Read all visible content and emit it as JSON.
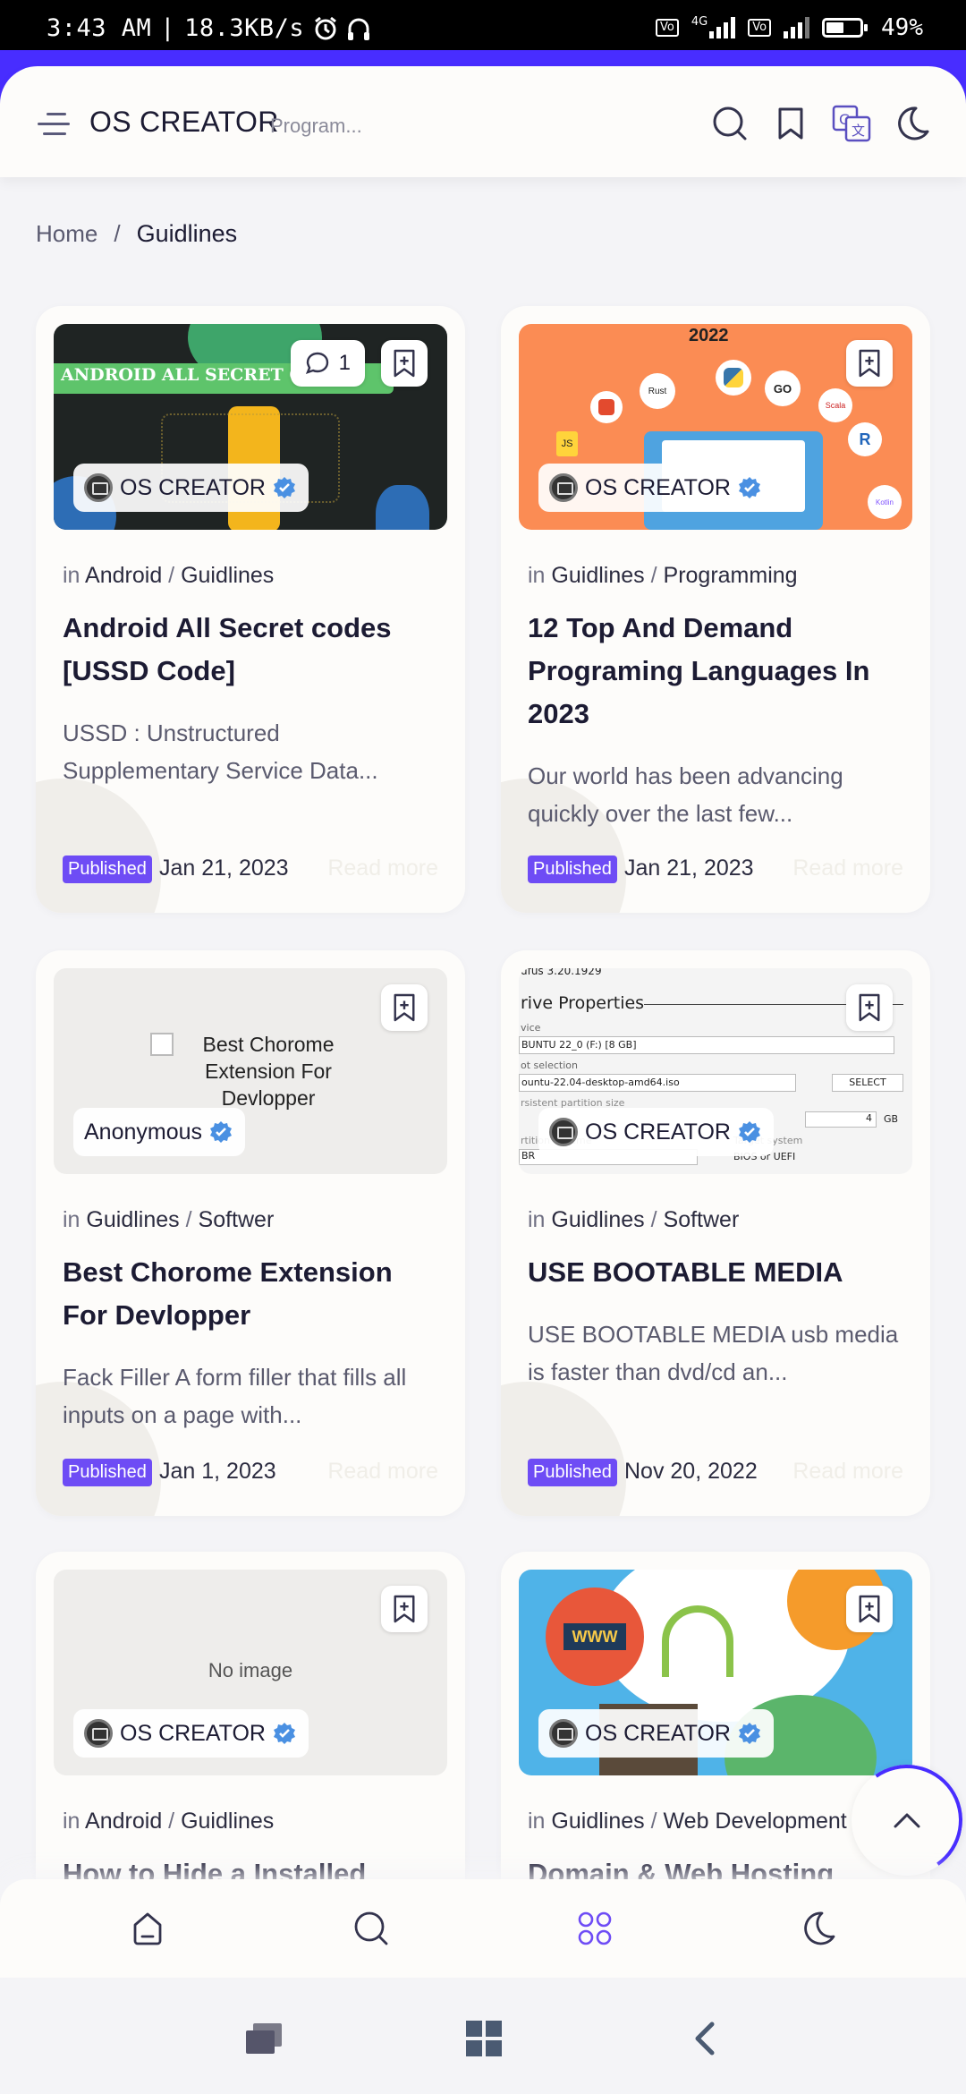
{
  "status_bar": {
    "time": "3:43 AM",
    "separator": "|",
    "speed": "18.3KB/s",
    "network": "4G",
    "battery": "49%"
  },
  "header": {
    "brand": "OS CREATOR",
    "subtitle": "Program..."
  },
  "breadcrumb": {
    "home": "Home",
    "separator": "/",
    "current": "Guidlines"
  },
  "posts": [
    {
      "category_prefix": "in",
      "category_1": "Android",
      "category_sep": "/",
      "category_2": "Guidlines",
      "title": "Android All Secret codes [USSD Code]",
      "excerpt": "USSD : Unstructured Supplementary Service Data...",
      "badge": "Published",
      "date": "Jan 21, 2023",
      "read_more": "Read more",
      "author": "OS CREATOR",
      "comments": "1",
      "thumb_text": "ANDROID ALL SECRET CODES"
    },
    {
      "category_prefix": "in",
      "category_1": "Guidlines",
      "category_sep": "/",
      "category_2": "Programming",
      "title": "12 Top And Demand Programing Languages In 2023",
      "excerpt": "Our world has been advancing quickly over the last few...",
      "badge": "Published",
      "date": "Jan 21, 2023",
      "read_more": "Read more",
      "author": "OS CREATOR",
      "thumb_text": "2022",
      "thumb_badges": [
        "Rust",
        "GO",
        "Scala",
        "R",
        "Kotlin",
        "JS"
      ]
    },
    {
      "category_prefix": "in",
      "category_1": "Guidlines",
      "category_sep": "/",
      "category_2": "Softwer",
      "title": "Best Chorome Extension For Devlopper",
      "excerpt": "Fack Filler A form filler that fills all inputs on a page with...",
      "badge": "Published",
      "date": "Jan 1, 2023",
      "read_more": "Read more",
      "author": "Anonymous",
      "thumb_alt": "Best Chorome Extension For Devlopper"
    },
    {
      "category_prefix": "in",
      "category_1": "Guidlines",
      "category_sep": "/",
      "category_2": "Softwer",
      "title": "USE BOOTABLE MEDIA",
      "excerpt": "USE BOOTABLE MEDIA usb media is faster than dvd/cd an...",
      "badge": "Published",
      "date": "Nov 20, 2022",
      "read_more": "Read more",
      "author": "OS CREATOR",
      "thumb_lines": {
        "version": "ufus 3.20.1929",
        "heading": "rive Properties",
        "device_label": "vice",
        "device": "BUNTU 22_0 (F:) [8 GB]",
        "boot_label": "ot selection",
        "iso": "ountu-22.04-desktop-amd64.iso",
        "select": "SELECT",
        "persist": "rsistent partition size",
        "size": "4",
        "unit": "GB",
        "scheme_label": "rtition scheme",
        "target_label": "Target system",
        "scheme": "BR",
        "target": "BIOS or UEFI"
      }
    },
    {
      "category_prefix": "in",
      "category_1": "Android",
      "category_sep": "/",
      "category_2": "Guidlines",
      "title": "How to Hide a Installed",
      "author": "OS CREATOR",
      "thumb_text": "No image"
    },
    {
      "category_prefix": "in",
      "category_1": "Guidlines",
      "category_sep": "/",
      "category_2": "Web Development",
      "title": "Domain & Web Hosting",
      "author": "OS CREATOR",
      "thumb_text": "WWW"
    }
  ],
  "colors": {
    "accent": "#482dff",
    "badge": "#6e4cf5",
    "card": "#fdfcfa",
    "background": "#f4f4f7"
  },
  "icons": {
    "header": [
      "menu-icon",
      "search-icon",
      "bookmark-icon",
      "translate-icon",
      "dark-mode-icon"
    ],
    "app_nav": [
      "home-icon",
      "search-icon",
      "apps-icon",
      "dark-mode-icon"
    ],
    "system_nav": [
      "recents-icon",
      "home-icon",
      "back-icon"
    ]
  }
}
